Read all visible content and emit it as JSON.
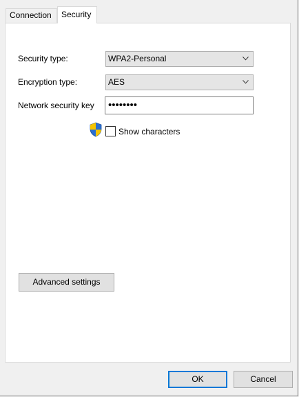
{
  "tabs": [
    {
      "label": "Connection"
    },
    {
      "label": "Security"
    }
  ],
  "form": {
    "security_type_label": "Security type:",
    "security_type_value": "WPA2-Personal",
    "encryption_type_label": "Encryption type:",
    "encryption_type_value": "AES",
    "network_key_label": "Network security key",
    "network_key_value": "••••••••",
    "show_characters_label": "Show characters",
    "show_characters_checked": false
  },
  "buttons": {
    "advanced_settings": "Advanced settings",
    "ok": "OK",
    "cancel": "Cancel"
  },
  "icons": {
    "uac_shield": "uac-shield-icon",
    "dropdown": "chevron-down-icon"
  },
  "colors": {
    "default_button_border": "#0078d7",
    "shield_blue": "#2a6fd1",
    "shield_yellow": "#f5c400"
  }
}
